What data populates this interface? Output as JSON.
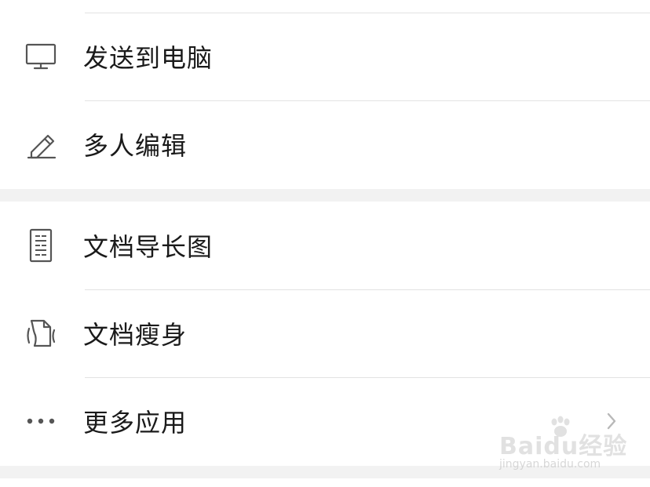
{
  "menu": {
    "items": [
      {
        "label": "发送到电脑",
        "icon": "monitor-icon"
      },
      {
        "label": "多人编辑",
        "icon": "pencil-icon"
      },
      {
        "label": "文档导长图",
        "icon": "long-document-icon"
      },
      {
        "label": "文档瘦身",
        "icon": "slim-document-icon"
      },
      {
        "label": "更多应用",
        "icon": "more-dots-icon",
        "has_chevron": true
      }
    ]
  },
  "watermark": {
    "logo_text": "Baidu经验",
    "url_text": "jingyan.baidu.com"
  },
  "colors": {
    "background": "#ffffff",
    "section_gap": "#f2f2f2",
    "divider": "#e3e3e3",
    "text": "#1a1a1a",
    "icon": "#555555",
    "chevron": "#b8b8b8"
  }
}
